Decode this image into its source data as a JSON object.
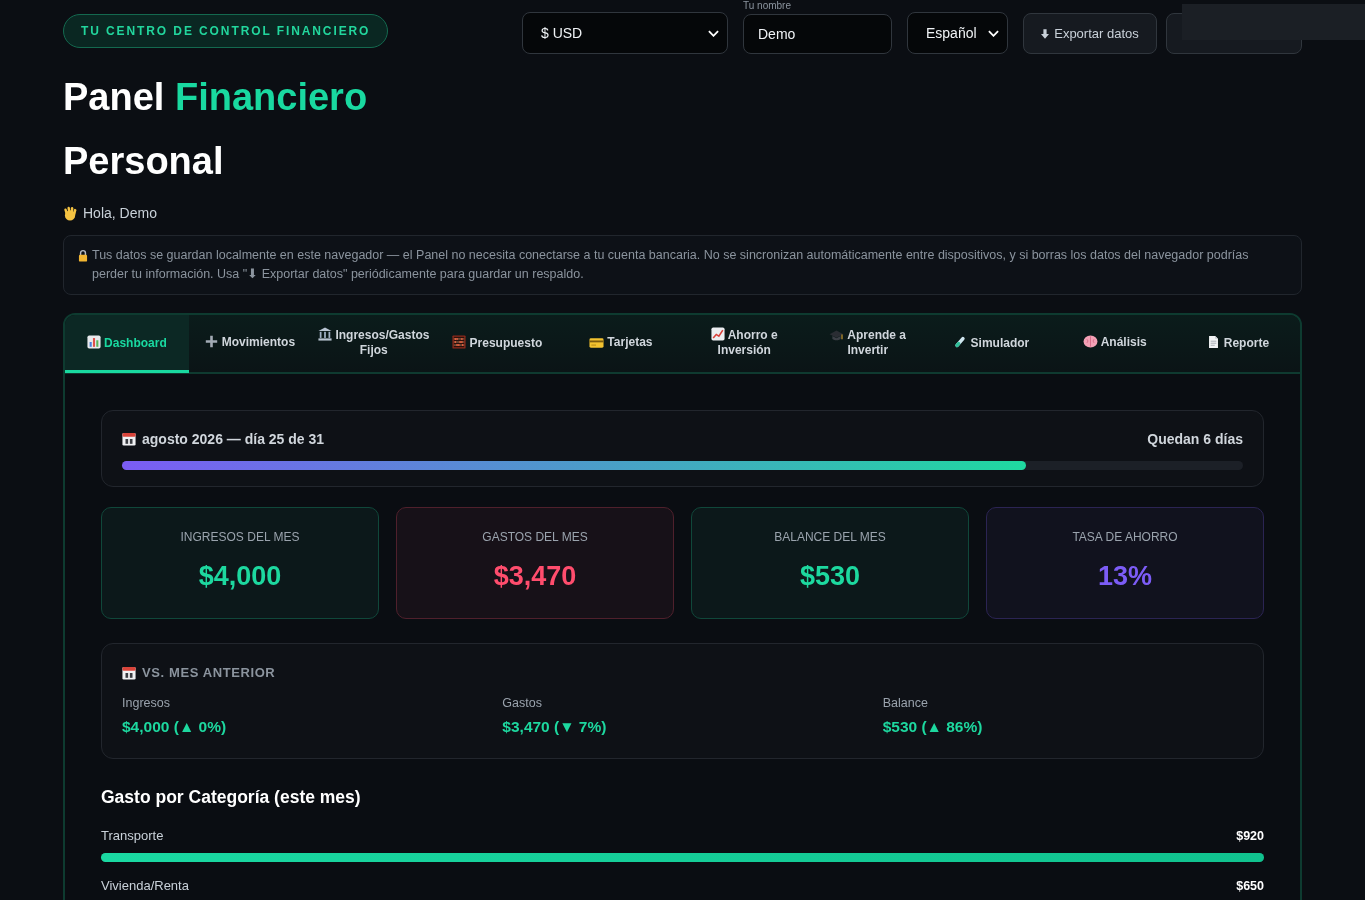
{
  "header": {
    "badge": "TU CENTRO DE CONTROL FINANCIERO",
    "title": "Panel **Financiero** Personal",
    "greeting": "Hola, Demo"
  },
  "controls": {
    "currency": "$ USD",
    "name_label": "Tu nombre",
    "name_value": "Demo",
    "language": "Español",
    "export_button": "Exportar datos"
  },
  "notice": "Tus datos se guardan localmente en este navegador — el Panel no necesita conectarse a tu cuenta bancaria. No se sincronizan automáticamente entre dispositivos, y si borras los datos del navegador podrías perder tu información. Usa \"⬇ Exportar datos\" periódicamente para guardar un respaldo.",
  "tabs": [
    {
      "label": "Dashboard",
      "selected": true
    },
    {
      "label": "Movimientos",
      "selected": false
    },
    {
      "label": "Ingresos/Gastos Fijos",
      "selected": false
    },
    {
      "label": "Presupuesto",
      "selected": false
    },
    {
      "label": "Tarjetas",
      "selected": false
    },
    {
      "label": "Ahorro e Inversión",
      "selected": false
    },
    {
      "label": "Aprende a Invertir",
      "selected": false
    },
    {
      "label": "Simulador",
      "selected": false
    },
    {
      "label": "Análisis",
      "selected": false
    },
    {
      "label": "Reporte",
      "selected": false
    }
  ],
  "month": {
    "label": "agosto 2026 — día 25 de 31",
    "remaining": "Quedan 6 días",
    "level": 0.806
  },
  "stats": [
    {
      "label": "INGRESOS DEL MES",
      "value": "$4,000",
      "color": "#1dd89f"
    },
    {
      "label": "GASTOS DEL MES",
      "value": "$3,470",
      "color": "#ff4d6d"
    },
    {
      "label": "BALANCE DEL MES",
      "value": "$530",
      "color": "#1dd89f"
    },
    {
      "label": "TASA DE AHORRO",
      "value": "13%",
      "color": "#7c5cf6"
    }
  ],
  "comparison": {
    "title": "VS. MES ANTERIOR",
    "items": [
      {
        "label": "Ingresos",
        "value": "$4,000 (▲ 0%)"
      },
      {
        "label": "Gastos",
        "value": "$3,470 (▼ 7%)"
      },
      {
        "label": "Balance",
        "value": "$530 (▲ 86%)"
      }
    ]
  },
  "categories": {
    "title": "Gasto por Categoría (este mes)",
    "items": [
      {
        "name": "Transporte",
        "amount": "$920",
        "level": 1
      },
      {
        "name": "Vivienda/Renta",
        "amount": "$650"
      }
    ]
  }
}
